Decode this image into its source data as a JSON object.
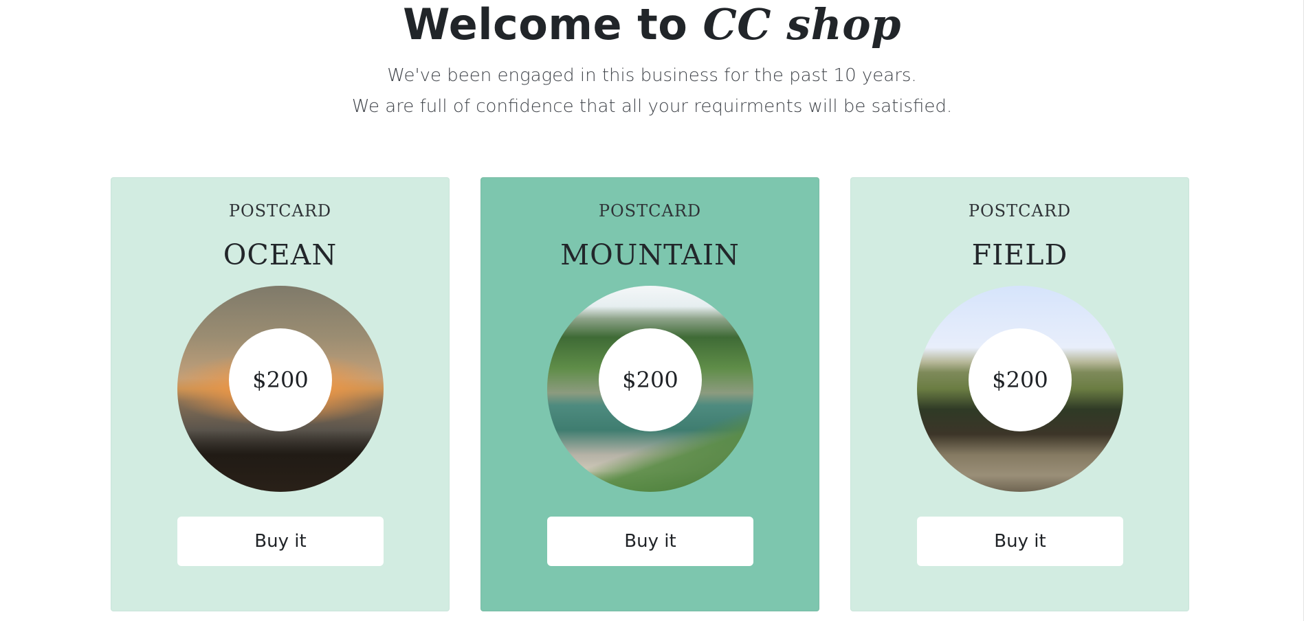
{
  "header": {
    "title_prefix": "Welcome to ",
    "brand": "CC shop",
    "lead_line_1": "We've been engaged in this business for the past 10 years.",
    "lead_line_2": "We are full of confidence that all your requirments will be satisfied."
  },
  "products": [
    {
      "kicker": "POSTCARD",
      "name": "OCEAN",
      "price": "$200",
      "button": "Buy it"
    },
    {
      "kicker": "POSTCARD",
      "name": "MOUNTAIN",
      "price": "$200",
      "button": "Buy it"
    },
    {
      "kicker": "POSTCARD",
      "name": "FIELD",
      "price": "$200",
      "button": "Buy it"
    }
  ],
  "colors": {
    "card_light": "#d2ece1",
    "card_featured": "#7dc6ae",
    "text": "#212529"
  }
}
